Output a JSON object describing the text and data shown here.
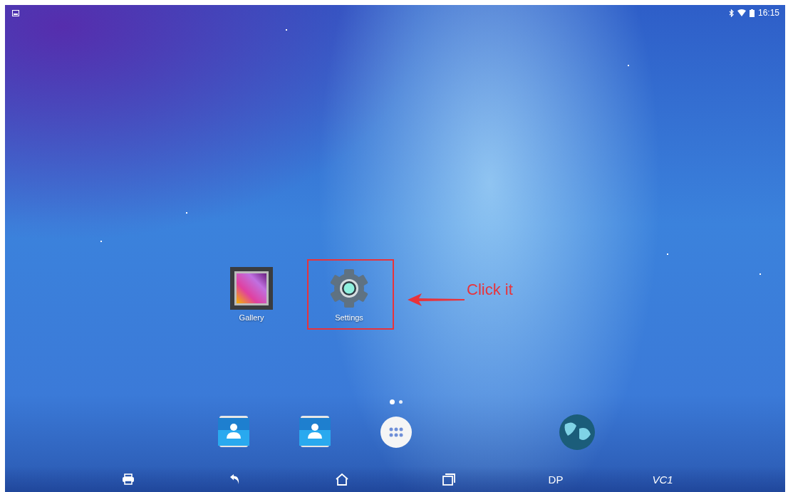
{
  "status_bar": {
    "time": "16:15"
  },
  "home_apps": [
    {
      "label": "Gallery",
      "kind": "gallery"
    },
    {
      "label": "Settings",
      "kind": "settings"
    }
  ],
  "annotation": {
    "text": "Click it"
  },
  "page_indicator": [
    {
      "selected": true
    },
    {
      "selected": false
    }
  ],
  "dock": [
    {
      "kind": "contacts"
    },
    {
      "kind": "contacts"
    },
    {
      "kind": "apps"
    },
    {
      "kind": "globe"
    }
  ],
  "nav_bar": [
    {
      "kind": "printer"
    },
    {
      "kind": "back"
    },
    {
      "kind": "home"
    },
    {
      "kind": "recents"
    },
    {
      "kind": "text",
      "label": "DP"
    },
    {
      "kind": "vci",
      "label": "VC1"
    }
  ]
}
